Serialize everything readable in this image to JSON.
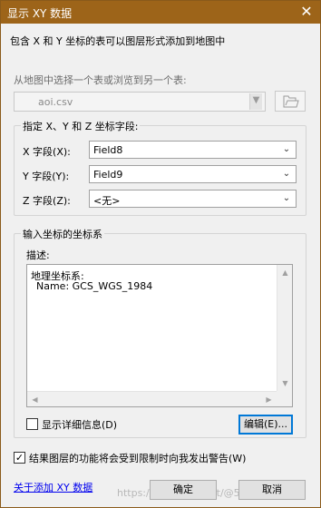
{
  "window": {
    "title": "显示 XY 数据",
    "close_glyph": "✕"
  },
  "intro_text": "包含 X 和 Y 坐标的表可以图层形式添加到地图中",
  "table_select": {
    "label": "从地图中选择一个表或浏览到另一个表:",
    "value": "aoi.csv",
    "browse_icon": "folder-open-icon"
  },
  "fields_group": {
    "legend": "指定 X、Y 和 Z 坐标字段:",
    "x": {
      "label": "X 字段(X):",
      "value": "Field8"
    },
    "y": {
      "label": "Y 字段(Y):",
      "value": "Field9"
    },
    "z": {
      "label": "Z 字段(Z):",
      "value": "<无>"
    }
  },
  "crs_group": {
    "legend": "输入坐标的坐标系",
    "description_label": "描述:",
    "description_line1": "地理坐标系:",
    "description_line2": "Name: GCS_WGS_1984",
    "show_details_label": "显示详细信息(D)",
    "show_details_checked": false,
    "edit_button": "编辑(E)..."
  },
  "warn_checkbox": {
    "label": "结果图层的功能将会受到限制时向我发出警告(W)",
    "checked": true
  },
  "footer": {
    "help_link": "关于添加 XY 数据",
    "ok_button": "确定",
    "cancel_button": "取消",
    "watermark": "https://blog.csdn.net/@51CTO博客"
  },
  "colors": {
    "titlebar": "#9d6419",
    "dialog_bg": "#f0f0f0"
  }
}
